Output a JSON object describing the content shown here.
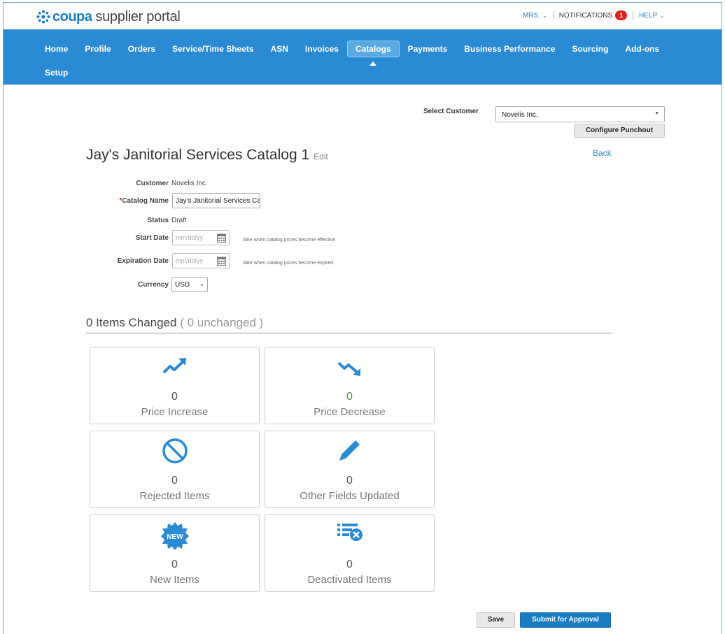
{
  "header": {
    "brand": "coupa",
    "subtitle": "supplier portal",
    "user_menu": "MRS.",
    "notifications_label": "NOTIFICATIONS",
    "notifications_count": "1",
    "help_menu": "HELP"
  },
  "nav": {
    "row1": [
      "Home",
      "Profile",
      "Orders",
      "Service/Time Sheets",
      "ASN",
      "Invoices",
      "Catalogs",
      "Payments",
      "Business Performance",
      "Sourcing",
      "Add-ons"
    ],
    "row2": [
      "Setup"
    ],
    "active": "Catalogs"
  },
  "customer_select": {
    "label": "Select Customer",
    "value": "Novelis Inc.",
    "configure_button": "Configure Punchout"
  },
  "page": {
    "title": "Jay's Janitorial Services Catalog 1",
    "edit_link": "Edit",
    "back_link": "Back"
  },
  "form": {
    "customer_label": "Customer",
    "customer_value": "Novelis Inc.",
    "catalog_name_label": "Catalog Name",
    "catalog_name_required": "*",
    "catalog_name_value": "Jay's Janitorial Services Cat",
    "status_label": "Status",
    "status_value": "Draft",
    "start_date_label": "Start Date",
    "start_date_placeholder": "mm/dd/yy",
    "start_date_hint": "date when catalog prices become effective",
    "expiration_date_label": "Expiration Date",
    "expiration_date_placeholder": "mm/dd/yy",
    "expiration_date_hint": "date when catalog prices become expired",
    "currency_label": "Currency",
    "currency_value": "USD"
  },
  "summary": {
    "heading": "0 Items Changed",
    "heading_muted": "( 0 unchanged )",
    "cards": [
      {
        "count": "0",
        "label": "Price Increase",
        "icon": "trend-up-icon"
      },
      {
        "count": "0",
        "label": "Price Decrease",
        "icon": "trend-down-icon",
        "count_color": "#3c9e2e"
      },
      {
        "count": "0",
        "label": "Rejected Items",
        "icon": "prohibited-icon"
      },
      {
        "count": "0",
        "label": "Other Fields Updated",
        "icon": "pencil-icon"
      },
      {
        "count": "0",
        "label": "New Items",
        "icon": "new-badge-icon",
        "badge_text": "NEW"
      },
      {
        "count": "0",
        "label": "Deactivated Items",
        "icon": "list-remove-icon"
      }
    ]
  },
  "actions": {
    "save": "Save",
    "submit": "Submit for Approval"
  },
  "colors": {
    "accent": "#2a8ad4",
    "brand": "#1a7cc1",
    "notification_badge": "#e1251b"
  }
}
